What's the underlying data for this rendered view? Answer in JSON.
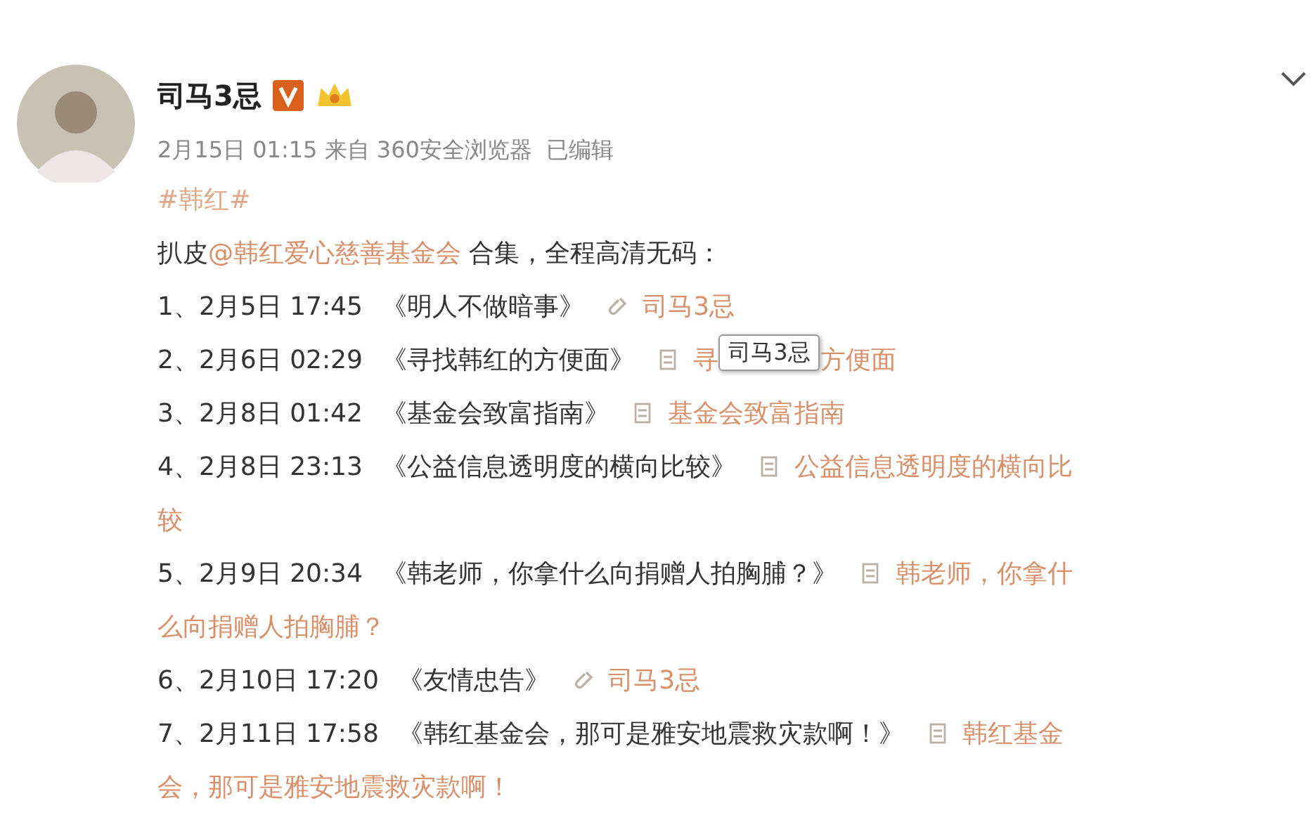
{
  "post": {
    "author": "司马3忌",
    "meta": "2月15日 01:15 来自 360安全浏览器  已编辑",
    "hashtag": "#韩红#",
    "intro": [
      {
        "kind": "text",
        "text": "扒皮"
      },
      {
        "kind": "mention",
        "text": "@韩红爱心慈善基金会"
      },
      {
        "kind": "text",
        "text": " 合集，全程高清无码："
      }
    ],
    "items": [
      {
        "number": "1、",
        "date": "2月5日 17:45",
        "title": "《明人不做暗事》",
        "kind": "link",
        "link": [
          "司马3忌"
        ]
      },
      {
        "number": "2、",
        "date": "2月6日 02:29",
        "title": "《寻找韩红的方便面》",
        "kind": "article",
        "link": [
          "寻",
          "方便面"
        ],
        "tooltip": "司马3忌"
      },
      {
        "number": "3、",
        "date": "2月8日 01:42",
        "title": "《基金会致富指南》",
        "kind": "article",
        "link": [
          "基金会致富指南"
        ]
      },
      {
        "number": "4、",
        "date": "2月8日 23:13",
        "title": "《公益信息透明度的横向比较》",
        "kind": "article",
        "link": [
          "公益信息透明度的横向比"
        ],
        "continuation": "较"
      },
      {
        "number": "5、",
        "date": "2月9日 20:34",
        "title": "《韩老师，你拿什么向捐赠人拍胸脯？》",
        "kind": "article",
        "link": [
          "韩老师，你拿什"
        ],
        "continuation": "么向捐赠人拍胸脯？"
      },
      {
        "number": "6、",
        "date": "2月10日 17:20",
        "title": "《友情忠告》",
        "kind": "link",
        "link": [
          "司马3忌"
        ]
      },
      {
        "number": "7、",
        "date": "2月11日 17:58",
        "title": "《韩红基金会，那可是雅安地震救灾款啊！》",
        "kind": "article",
        "link": [
          "韩红基金"
        ],
        "continuation": "会，那可是雅安地震救灾款啊！"
      }
    ]
  }
}
